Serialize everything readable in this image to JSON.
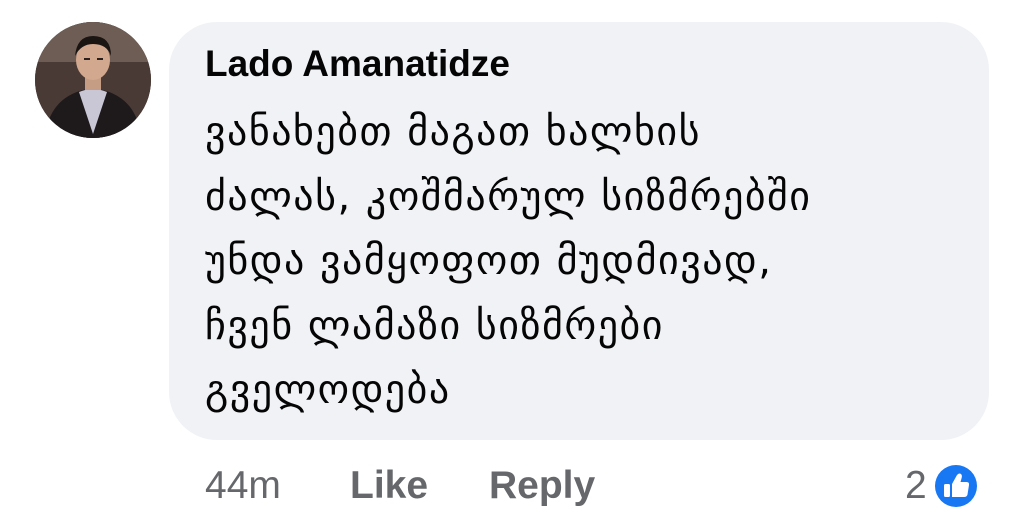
{
  "comment": {
    "author": "Lado Amanatidze",
    "text_lines": [
      "ვანახებთ მაგათ ხალხის",
      "ძალას, კოშმარულ სიზმრებში",
      "უნდა ვამყოფოთ მუდმივად,",
      "ჩვენ ლამაზი სიზმრები",
      "გველოდება"
    ],
    "timestamp": "44m",
    "like_label": "Like",
    "reply_label": "Reply",
    "reaction_count": "2",
    "reaction_icon": "like-thumbs-up-icon",
    "colors": {
      "bubble": "#f0f2f5",
      "text": "#050505",
      "meta": "#65676b",
      "like_accent": "#1877f2"
    }
  }
}
